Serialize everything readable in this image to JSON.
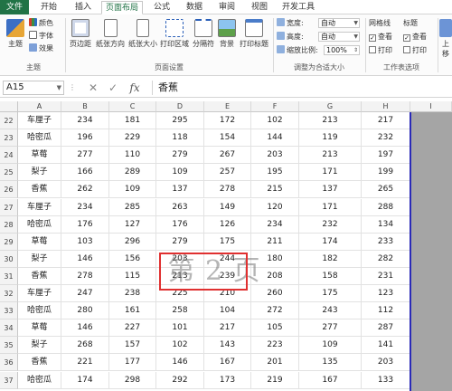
{
  "tabs": [
    {
      "label": "文件"
    },
    {
      "label": "开始"
    },
    {
      "label": "插入"
    },
    {
      "label": "页面布局"
    },
    {
      "label": "公式"
    },
    {
      "label": "数据"
    },
    {
      "label": "审阅"
    },
    {
      "label": "视图"
    },
    {
      "label": "开发工具"
    }
  ],
  "ribbon": {
    "theme": {
      "themes_label": "主题",
      "colors_label": "颜色",
      "fonts_label": "字体",
      "effects_label": "效果",
      "group_label": "主题"
    },
    "page_setup": {
      "margins_label": "页边距",
      "orientation_label": "纸张方向",
      "size_label": "纸张大小",
      "print_area_label": "打印区域",
      "breaks_label": "分隔符",
      "background_label": "背景",
      "print_titles_label": "打印标题",
      "group_label": "页面设置"
    },
    "scale": {
      "width_label": "宽度:",
      "width_value": "自动",
      "height_label": "高度:",
      "height_value": "自动",
      "scale_label": "缩放比例:",
      "scale_value": "100%",
      "group_label": "调整为合适大小"
    },
    "sheet_options": {
      "gridlines_label": "网格线",
      "headings_label": "标题",
      "view_label": "查看",
      "print_label": "打印",
      "group_label": "工作表选项"
    },
    "arrange": {
      "bring_forward_label": "上移"
    }
  },
  "formula_bar": {
    "name_box": "A15",
    "fx_label": "fx",
    "formula": "香蕉"
  },
  "columns": [
    "A",
    "B",
    "C",
    "D",
    "E",
    "F",
    "G",
    "H",
    "I"
  ],
  "rows": [
    {
      "num": "22",
      "cells": [
        "车厘子",
        "234",
        "181",
        "295",
        "172",
        "102",
        "213",
        "217"
      ]
    },
    {
      "num": "23",
      "cells": [
        "哈密瓜",
        "196",
        "229",
        "118",
        "154",
        "144",
        "119",
        "232"
      ]
    },
    {
      "num": "24",
      "cells": [
        "草莓",
        "277",
        "110",
        "279",
        "267",
        "203",
        "213",
        "197"
      ]
    },
    {
      "num": "25",
      "cells": [
        "梨子",
        "166",
        "289",
        "109",
        "257",
        "195",
        "171",
        "199"
      ]
    },
    {
      "num": "26",
      "cells": [
        "香蕉",
        "262",
        "109",
        "137",
        "278",
        "215",
        "137",
        "265"
      ]
    },
    {
      "num": "27",
      "cells": [
        "车厘子",
        "234",
        "285",
        "263",
        "149",
        "120",
        "171",
        "288"
      ]
    },
    {
      "num": "28",
      "cells": [
        "哈密瓜",
        "176",
        "127",
        "176",
        "126",
        "234",
        "232",
        "134"
      ]
    },
    {
      "num": "29",
      "cells": [
        "草莓",
        "103",
        "296",
        "279",
        "175",
        "211",
        "174",
        "233"
      ]
    },
    {
      "num": "30",
      "cells": [
        "梨子",
        "146",
        "156",
        "203",
        "244",
        "180",
        "182",
        "282"
      ]
    },
    {
      "num": "31",
      "cells": [
        "香蕉",
        "278",
        "115",
        "213",
        "239",
        "208",
        "158",
        "231"
      ]
    },
    {
      "num": "32",
      "cells": [
        "车厘子",
        "247",
        "238",
        "225",
        "210",
        "260",
        "175",
        "123"
      ]
    },
    {
      "num": "33",
      "cells": [
        "哈密瓜",
        "280",
        "161",
        "258",
        "104",
        "272",
        "243",
        "112"
      ]
    },
    {
      "num": "34",
      "cells": [
        "草莓",
        "146",
        "227",
        "101",
        "217",
        "105",
        "277",
        "287"
      ]
    },
    {
      "num": "35",
      "cells": [
        "梨子",
        "268",
        "157",
        "102",
        "143",
        "223",
        "109",
        "141"
      ]
    },
    {
      "num": "36",
      "cells": [
        "香蕉",
        "221",
        "177",
        "146",
        "167",
        "201",
        "135",
        "203"
      ]
    },
    {
      "num": "37",
      "cells": [
        "哈密瓜",
        "174",
        "298",
        "292",
        "173",
        "219",
        "167",
        "133"
      ]
    }
  ],
  "watermark_text": "第 2 页",
  "colors": {
    "file_tab": "#217346",
    "print_border": "#2a2ab8",
    "highlight_box": "#e03030",
    "gray_area": "#a5a5a5"
  }
}
